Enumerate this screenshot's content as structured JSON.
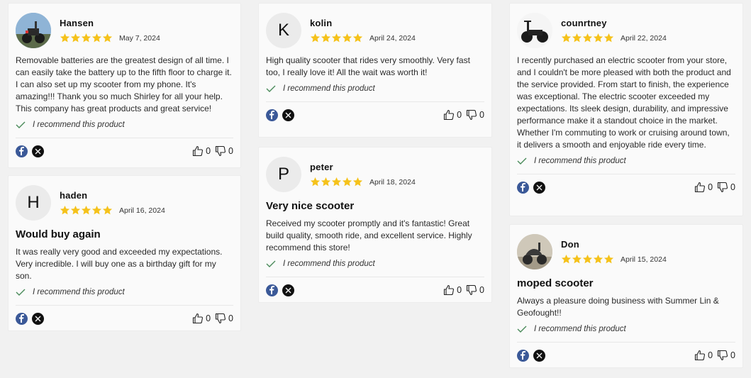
{
  "reviews": [
    {
      "name": "Hansen",
      "avatar_letter": "",
      "avatar_icon": "scooter-photo",
      "date": "May 7, 2024",
      "title": "",
      "body": "Removable batteries are the greatest design of all time. I can easily take the battery up to the fifth floor to charge it. I can also set up my scooter from my phone. It's amazing!!! Thank you so much Shirley for all your help. This company has great products and great service!",
      "recommend": "I recommend this product",
      "likes": "0",
      "dislikes": "0",
      "rating": 5
    },
    {
      "name": "haden",
      "avatar_letter": "H",
      "date": "April 16, 2024",
      "title": "Would buy again",
      "body": "It was really very good and exceeded my expectations. Very incredible. I will buy one as a birthday gift for my son.",
      "recommend": "I recommend this product",
      "likes": "0",
      "dislikes": "0",
      "rating": 5
    },
    {
      "name": "kolin",
      "avatar_letter": "K",
      "date": "April 24, 2024",
      "title": "",
      "body": "High quality scooter that rides very smoothly. Very fast too, I really love it! All the wait was worth it!",
      "recommend": "I recommend this product",
      "likes": "0",
      "dislikes": "0",
      "rating": 5
    },
    {
      "name": "peter",
      "avatar_letter": "P",
      "date": "April 18, 2024",
      "title": "Very nice scooter",
      "body": "Received my scooter promptly and it's fantastic! Great build quality, smooth ride, and excellent service. Highly recommend this store!",
      "recommend": "I recommend this product",
      "likes": "0",
      "dislikes": "0",
      "rating": 5
    },
    {
      "name": "counrtney",
      "avatar_letter": "",
      "avatar_icon": "scooter-photo",
      "date": "April 22, 2024",
      "title": "",
      "body": "I recently purchased an electric scooter from your store, and I couldn't be more pleased with both the product and the service provided. From start to finish, the experience was exceptional. The electric scooter exceeded my expectations. Its sleek design, durability, and impressive performance make it a standout choice in the market. Whether I'm commuting to work or cruising around town, it delivers a smooth and enjoyable ride every time.",
      "recommend": "I recommend this product",
      "likes": "0",
      "dislikes": "0",
      "rating": 5
    },
    {
      "name": "Don",
      "avatar_letter": "",
      "avatar_icon": "moped-photo",
      "date": "April 15, 2024",
      "title": "moped scooter",
      "body": "Always a pleasure doing business with Summer Lin & Geofought!!",
      "recommend": "I recommend this product",
      "likes": "0",
      "dislikes": "0",
      "rating": 5
    }
  ],
  "colors": {
    "star": "#f5c21b",
    "facebook": "#3b5998",
    "x": "#111111",
    "check": "#4a8a5a"
  }
}
